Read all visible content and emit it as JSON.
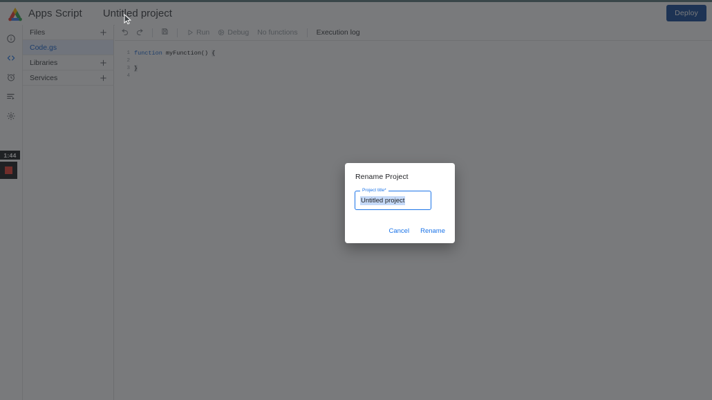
{
  "header": {
    "brand": "Apps Script",
    "project_title": "Untitled project",
    "deploy_label": "Deploy",
    "logo_icon": "apps-script-logo",
    "accent_blue": "#1a73e8",
    "deploy_bg": "#1a4f9c"
  },
  "rail": {
    "items": [
      {
        "icon": "info-icon",
        "name": "overview",
        "active": false
      },
      {
        "icon": "code-icon",
        "name": "editor",
        "active": true
      },
      {
        "icon": "clock-icon",
        "name": "triggers",
        "active": false
      },
      {
        "icon": "executions-icon",
        "name": "executions",
        "active": false
      },
      {
        "icon": "gear-icon",
        "name": "project-settings",
        "active": false
      }
    ],
    "recorder": {
      "timer": "1:44",
      "stop_icon": "stop-square-icon",
      "stop_color": "#ea4335"
    }
  },
  "files_panel": {
    "sections": [
      {
        "label": "Files",
        "add_icon": "plus-icon"
      },
      {
        "label": "Libraries",
        "add_icon": "plus-icon"
      },
      {
        "label": "Services",
        "add_icon": "plus-icon"
      }
    ],
    "files": [
      {
        "label": "Code.gs",
        "selected": true
      }
    ]
  },
  "toolbar": {
    "undo_icon": "undo-icon",
    "redo_icon": "redo-icon",
    "save_icon": "save-icon",
    "run_label": "Run",
    "run_icon": "play-icon",
    "debug_label": "Debug",
    "debug_icon": "debug-icon",
    "functions_label": "No functions",
    "execution_log_label": "Execution log"
  },
  "editor": {
    "lines": [
      {
        "number": "1",
        "kw": "function",
        "rest": " myFunction() ",
        "brace": "{"
      },
      {
        "number": "2",
        "kw": "",
        "rest": "",
        "brace": ""
      },
      {
        "number": "3",
        "kw": "",
        "rest": "",
        "brace": "}"
      },
      {
        "number": "4",
        "kw": "",
        "rest": "",
        "brace": ""
      }
    ]
  },
  "dialog": {
    "title": "Rename Project",
    "field_label": "Project title*",
    "field_value": "Untitled project",
    "cancel_label": "Cancel",
    "rename_label": "Rename"
  }
}
